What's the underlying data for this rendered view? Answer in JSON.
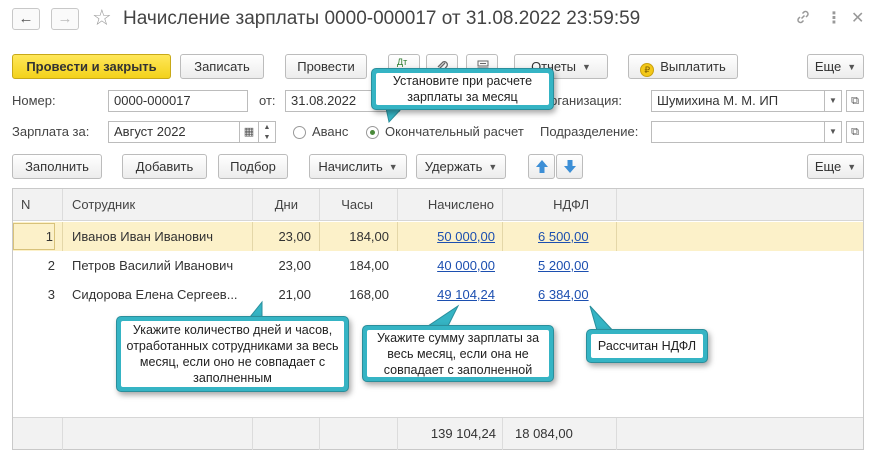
{
  "window": {
    "title": "Начисление зарплаты 0000-000017 от 31.08.2022 23:59:59"
  },
  "toolbar": {
    "post_close_label": "Провести и закрыть",
    "save_label": "Записать",
    "post_label": "Провести",
    "dt_label": "Дт",
    "reports_label": "Отчеты",
    "pay_label": "Выплатить",
    "more_label": "Еще"
  },
  "form": {
    "number_label": "Номер:",
    "number_value": "0000-000017",
    "date_label": "от:",
    "date_value": "31.08.2022",
    "org_label": "Организация:",
    "org_value": "Шумихина М. М. ИП",
    "salary_for_label": "Зарплата за:",
    "salary_for_value": "Август 2022",
    "advance_label": "Аванс",
    "final_label": "Окончательный расчет",
    "final_selected": true,
    "dept_label": "Подразделение:",
    "dept_value": ""
  },
  "table_toolbar": {
    "fill_label": "Заполнить",
    "add_label": "Добавить",
    "pick_label": "Подбор",
    "accrue_label": "Начислить",
    "withhold_label": "Удержать",
    "more_label": "Еще"
  },
  "table": {
    "columns": [
      "N",
      "Сотрудник",
      "Дни",
      "Часы",
      "Начислено",
      "НДФЛ"
    ],
    "rows": [
      {
        "n": "1",
        "employee": "Иванов Иван Иванович",
        "days": "23,00",
        "hours": "184,00",
        "accrued": "50 000,00",
        "ndfl": "6 500,00"
      },
      {
        "n": "2",
        "employee": "Петров Василий Иванович",
        "days": "23,00",
        "hours": "184,00",
        "accrued": "40 000,00",
        "ndfl": "5 200,00"
      },
      {
        "n": "3",
        "employee": "Сидорова Елена Сергеев...",
        "days": "21,00",
        "hours": "168,00",
        "accrued": "49 104,24",
        "ndfl": "6 384,00"
      }
    ],
    "total_accrued": "139 104,24",
    "total_ndfl": "18 084,00"
  },
  "callouts": {
    "month": "Установите при расчете зарплаты за месяц",
    "days_hours": "Укажите количество дней и часов, отработанных сотрудниками за весь месяц, если оно не совпадает с заполненным",
    "salary_sum": "Укажите сумму зарплаты за весь месяц, если она не совпадает с заполненной",
    "ndfl": "Рассчитан НДФЛ"
  },
  "colors": {
    "primary_button": "#f3d21a",
    "selected_row": "#fcf1c9",
    "link": "#1c4fb0",
    "callout_border": "#35b4c4"
  }
}
